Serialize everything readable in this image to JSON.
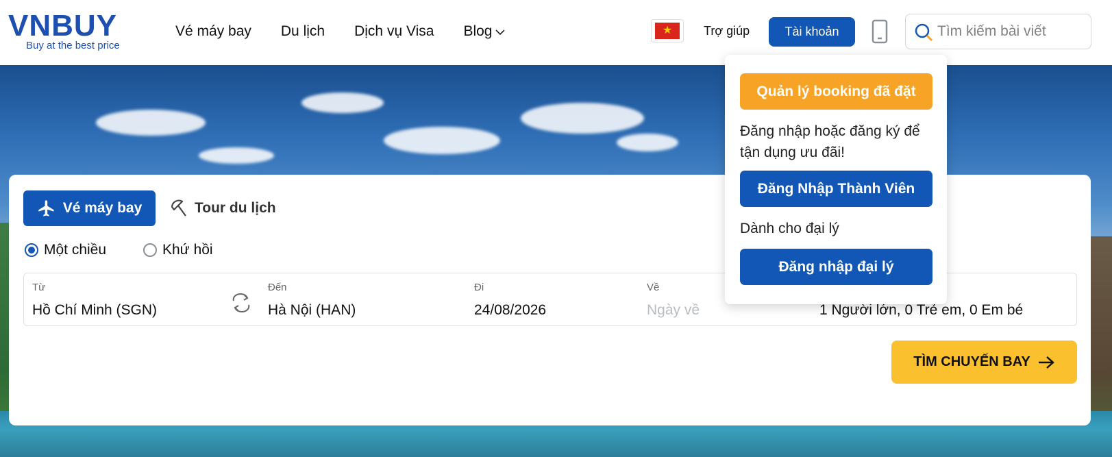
{
  "header": {
    "logo_text": "VNBUY",
    "logo_tagline": "Buy at the best price",
    "nav": [
      {
        "label": "Vé máy bay"
      },
      {
        "label": "Du lịch"
      },
      {
        "label": "Dịch vụ Visa"
      },
      {
        "label": "Blog"
      }
    ],
    "help_label": "Trợ giúp",
    "account_label": "Tài khoản",
    "search_placeholder": "Tìm kiếm bài viết"
  },
  "account_menu": {
    "manage_booking_label": "Quản lý booking đã đặt",
    "login_prompt": "Đăng nhập hoặc đăng ký để tận dụng ưu đãi!",
    "member_login_label": "Đăng Nhập Thành Viên",
    "agent_prompt": "Dành cho đại lý",
    "agent_login_label": "Đăng nhập đại lý"
  },
  "booking": {
    "tabs": [
      {
        "label": "Vé máy bay",
        "active": true
      },
      {
        "label": "Tour du lịch",
        "active": false
      }
    ],
    "trip_types": [
      {
        "label": "Một chiều",
        "checked": true
      },
      {
        "label": "Khứ hồi",
        "checked": false
      }
    ],
    "from": {
      "label": "Từ",
      "value": "Hồ Chí Minh (SGN)"
    },
    "to": {
      "label": "Đến",
      "value": "Hà Nội (HAN)"
    },
    "depart": {
      "label": "Đi",
      "value": "24/08/2026"
    },
    "return": {
      "label": "Về",
      "placeholder": "Ngày về"
    },
    "passengers": {
      "value": "1 Người lớn, 0 Trẻ em, 0 Em bé"
    },
    "submit_label": "TÌM CHUYẾN BAY"
  },
  "colors": {
    "brand_blue": "#1257b5",
    "accent_yellow": "#fbc02d",
    "accent_orange": "#f7a325"
  }
}
